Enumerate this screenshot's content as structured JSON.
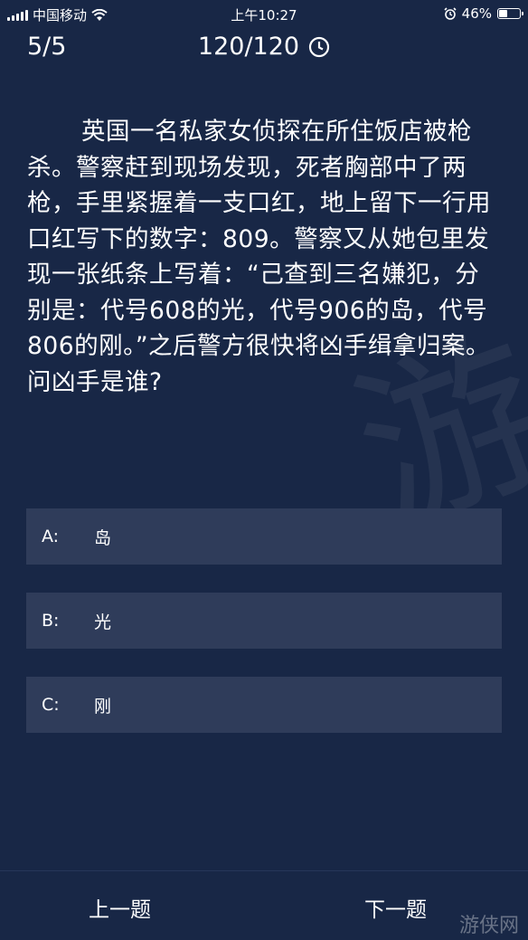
{
  "status_bar": {
    "carrier": "中国移动",
    "time": "上午10:27",
    "battery": "46%",
    "battery_fraction": 0.46
  },
  "header": {
    "progress": "5/5",
    "score": "120/120"
  },
  "question": {
    "text": "英国一名私家女侦探在所住饭店被枪杀。警察赶到现场发现，死者胸部中了两枪，手里紧握着一支口红，地上留下一行用口红写下的数字：809。警察又从她包里发现一张纸条上写着：“己查到三名嫌犯，分别是：代号608的光，代号906的岛，代号806的刚。”之后警方很快将凶手缉拿归案。问凶手是谁?"
  },
  "options": [
    {
      "key": "A:",
      "label": "岛"
    },
    {
      "key": "B:",
      "label": "光"
    },
    {
      "key": "C:",
      "label": "刚"
    }
  ],
  "footer": {
    "prev_label": "上一题",
    "next_label": "下一题",
    "watermark": "游侠网"
  }
}
